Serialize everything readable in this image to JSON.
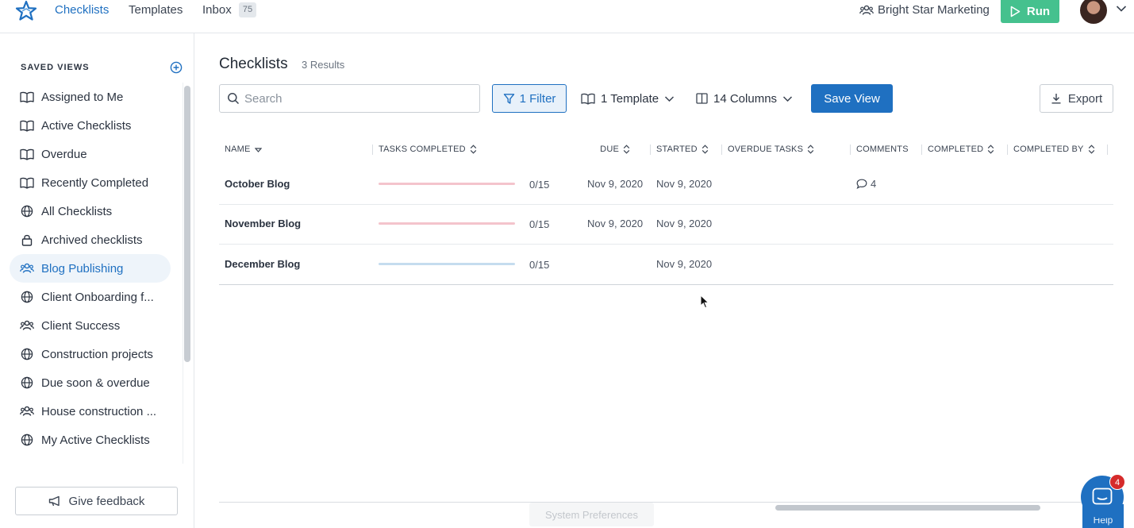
{
  "nav": {
    "links": [
      "Checklists",
      "Templates",
      "Inbox"
    ],
    "inbox_count": "75",
    "org_name": "Bright Star Marketing",
    "run_label": "Run"
  },
  "sidebar": {
    "title": "SAVED VIEWS",
    "items": [
      {
        "label": "Assigned to Me",
        "icon": "book-icon"
      },
      {
        "label": "Active Checklists",
        "icon": "book-icon"
      },
      {
        "label": "Overdue",
        "icon": "book-icon"
      },
      {
        "label": "Recently Completed",
        "icon": "book-icon"
      },
      {
        "label": "All Checklists",
        "icon": "globe-icon"
      },
      {
        "label": "Archived checklists",
        "icon": "lock-icon"
      },
      {
        "label": "Blog Publishing",
        "icon": "users-icon",
        "active": true
      },
      {
        "label": "Client Onboarding f...",
        "icon": "globe-icon"
      },
      {
        "label": "Client Success",
        "icon": "users-icon"
      },
      {
        "label": "Construction projects",
        "icon": "globe-icon"
      },
      {
        "label": "Due soon & overdue",
        "icon": "globe-icon"
      },
      {
        "label": "House construction ...",
        "icon": "users-icon"
      },
      {
        "label": "My Active Checklists",
        "icon": "globe-icon"
      }
    ],
    "feedback_label": "Give feedback"
  },
  "main": {
    "title": "Checklists",
    "result_count": "3 Results",
    "search_placeholder": "Search",
    "filter_label": "1 Filter",
    "template_label": "1 Template",
    "columns_label": "14 Columns",
    "save_view_label": "Save View",
    "export_label": "Export"
  },
  "table": {
    "headers": {
      "name": "NAME",
      "tasks_completed": "TASKS COMPLETED",
      "due": "DUE",
      "started": "STARTED",
      "overdue_tasks": "OVERDUE TASKS",
      "comments": "COMMENTS",
      "completed": "COMPLETED",
      "completed_by": "COMPLETED BY"
    },
    "rows": [
      {
        "name": "October Blog",
        "tasks": "0/15",
        "progress": 0,
        "progress_color": "#f4c4cc",
        "due": "Nov 9, 2020",
        "started": "Nov 9, 2020",
        "comments": "4"
      },
      {
        "name": "November Blog",
        "tasks": "0/15",
        "progress": 0,
        "progress_color": "#f4c4cc",
        "due": "Nov 9, 2020",
        "started": "Nov 9, 2020",
        "comments": ""
      },
      {
        "name": "December Blog",
        "tasks": "0/15",
        "progress": 0,
        "progress_color": "#c5dcef",
        "due": "",
        "started": "Nov 9, 2020",
        "comments": ""
      }
    ]
  },
  "footer": {
    "system_preferences": "System Preferences",
    "help_label": "Help",
    "help_badge": "4"
  },
  "colors": {
    "accent": "#1f70c1",
    "run_green": "#45c18e",
    "overdue_bar": "#f4c4cc",
    "ontrack_bar": "#c5dcef"
  }
}
